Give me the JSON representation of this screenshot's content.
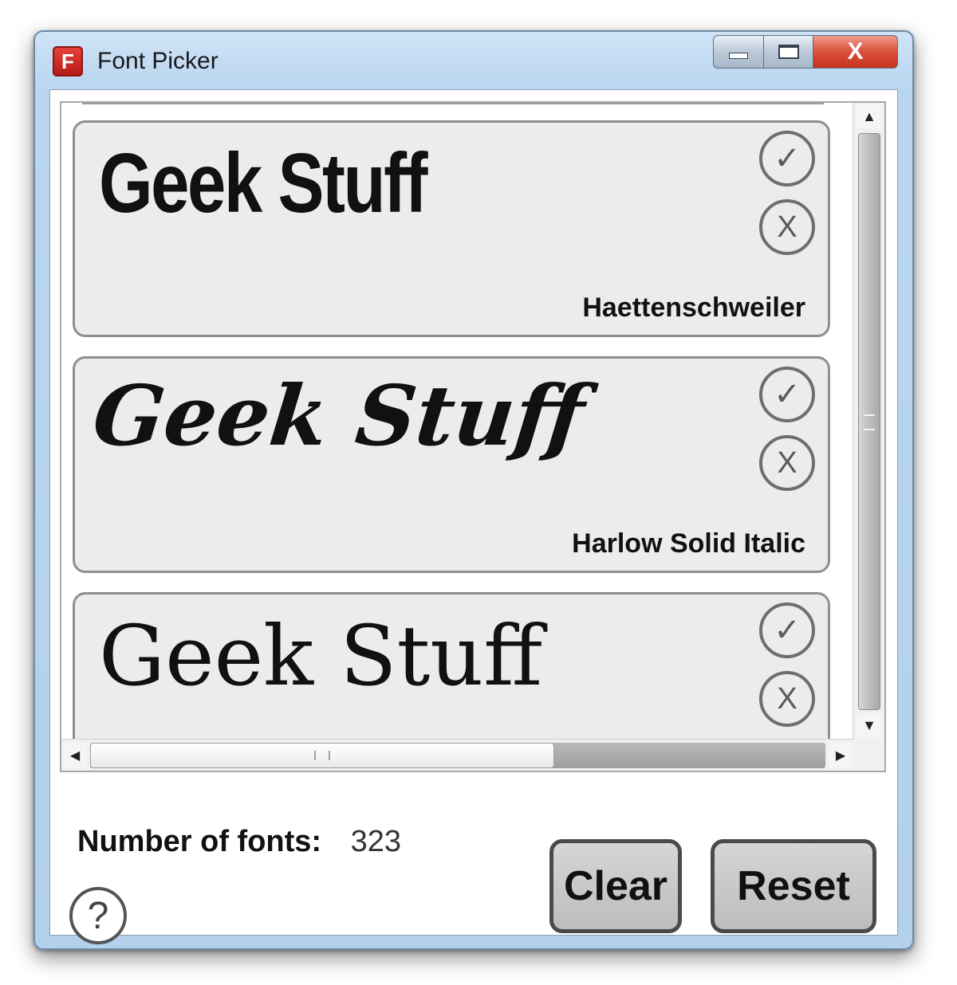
{
  "window": {
    "title": "Font Picker",
    "app_icon_letter": "F",
    "caption": {
      "minimize": "",
      "maximize": "",
      "close": "X"
    }
  },
  "fonts": [
    {
      "sample": "Geek Stuff",
      "name": "Haettenschweiler",
      "accept": "✓",
      "reject": "X"
    },
    {
      "sample": "Geek Stuff",
      "name": "Harlow Solid Italic",
      "accept": "✓",
      "reject": "X"
    },
    {
      "sample": "Geek Stuff",
      "name": "",
      "accept": "✓",
      "reject": "X"
    }
  ],
  "scrollbars": {
    "up_arrow": "▲",
    "down_arrow": "▼",
    "left_arrow": "◀",
    "right_arrow": "▶"
  },
  "footer": {
    "count_label": "Number of fonts:",
    "count_value": "323",
    "help_symbol": "?",
    "clear_label": "Clear",
    "reset_label": "Reset"
  },
  "colors": {
    "title_bar": "#bad6f0",
    "close_button": "#d9503b",
    "app_icon": "#c8221d",
    "card_background": "#ececec"
  }
}
